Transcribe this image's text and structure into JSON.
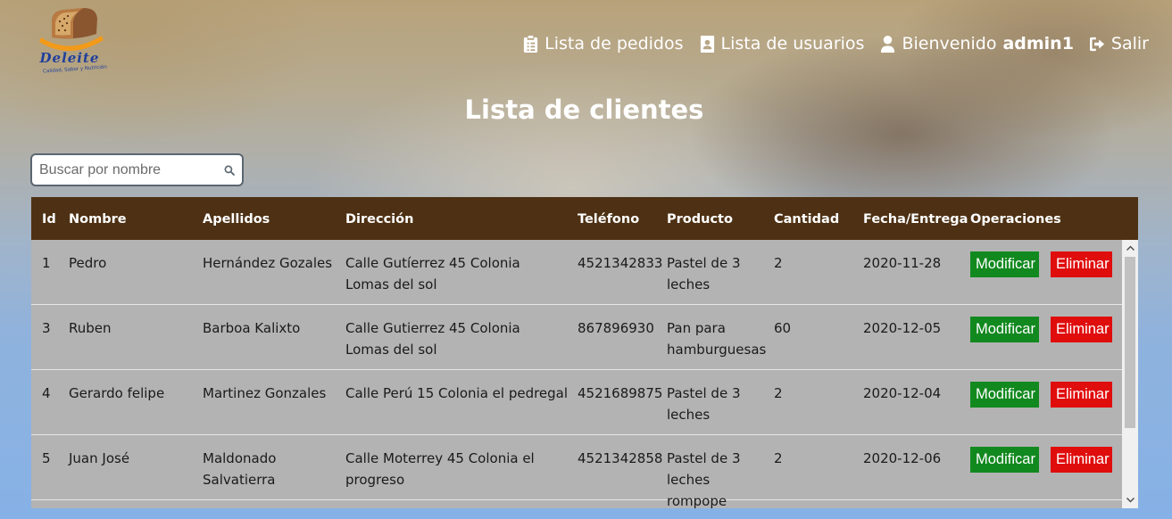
{
  "logo": {
    "name": "Deleite",
    "tagline": "Calidad, Sabor y Nutrición",
    "icon": "bread-icon"
  },
  "nav": {
    "orders": {
      "label": "Lista de pedidos",
      "icon": "clipboard-icon"
    },
    "users": {
      "label": "Lista de usuarios",
      "icon": "contact-book-icon"
    },
    "welcome": {
      "prefix": "Bienvenido",
      "username": "admin1",
      "icon": "user-icon"
    },
    "logout": {
      "label": "Salir",
      "icon": "sign-out-icon"
    }
  },
  "page": {
    "title": "Lista de clientes"
  },
  "search": {
    "placeholder": "Buscar por nombre",
    "value": "",
    "icon": "search-icon"
  },
  "table": {
    "headers": {
      "id": "Id",
      "nombre": "Nombre",
      "apellidos": "Apellidos",
      "direccion": "Dirección",
      "telefono": "Teléfono",
      "producto": "Producto",
      "cantidad": "Cantidad",
      "fecha": "Fecha/Entrega",
      "operaciones": "Operaciones"
    },
    "rows": [
      {
        "id": "1",
        "nombre": "Pedro",
        "apellidos": "Hernández Gozales",
        "direccion": "Calle Gutíerrez 45 Colonia Lomas del sol",
        "telefono": "4521342833",
        "producto": "Pastel de 3 leches",
        "cantidad": "2",
        "fecha": "2020-11-28",
        "modificar": "Modificar",
        "eliminar": "Eliminar"
      },
      {
        "id": "3",
        "nombre": "Ruben",
        "apellidos": "Barboa Kalixto",
        "direccion": "Calle Gutierrez 45 Colonia Lomas del sol",
        "telefono": "867896930",
        "producto": "Pan para hamburguesas",
        "cantidad": "60",
        "fecha": "2020-12-05",
        "modificar": "Modificar",
        "eliminar": "Eliminar"
      },
      {
        "id": "4",
        "nombre": "Gerardo felipe",
        "apellidos": "Martinez Gonzales",
        "direccion": "Calle Perú 15 Colonia el pedregal",
        "telefono": "4521689875",
        "producto": "Pastel de 3 leches",
        "cantidad": "2",
        "fecha": "2020-12-04",
        "modificar": "Modificar",
        "eliminar": "Eliminar"
      },
      {
        "id": "5",
        "nombre": "Juan José",
        "apellidos": "Maldonado Salvatierra",
        "direccion": "Calle Moterrey 45 Colonia el progreso",
        "telefono": "4521342858",
        "producto": "Pastel de 3 leches rompope",
        "cantidad": "2",
        "fecha": "2020-12-06",
        "modificar": "Modificar",
        "eliminar": "Eliminar"
      }
    ]
  },
  "colors": {
    "header_bg": "#4e3114",
    "row_bg": "#b3b3b3",
    "modify_button": "#12891f",
    "delete_button": "#e00d0d",
    "logo_blue": "#1f3f9c"
  }
}
